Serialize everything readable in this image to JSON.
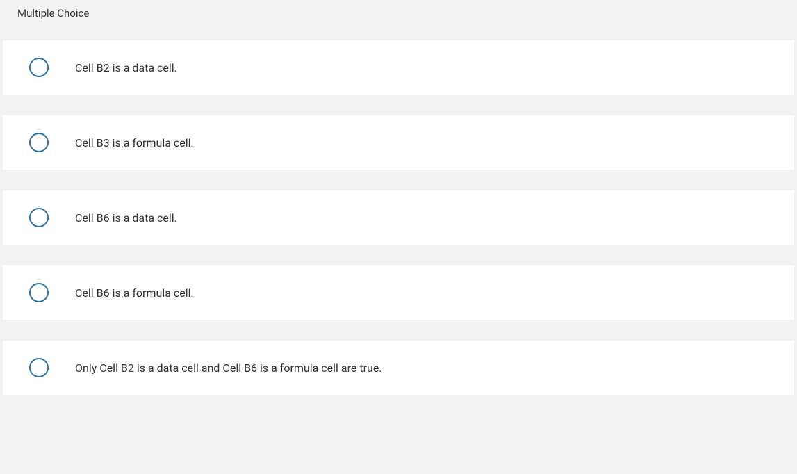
{
  "header": {
    "title": "Multiple Choice"
  },
  "options": [
    {
      "label": "Cell B2 is a data cell."
    },
    {
      "label": "Cell B3 is a formula cell."
    },
    {
      "label": "Cell B6 is a data cell."
    },
    {
      "label": "Cell B6 is a formula cell."
    },
    {
      "label": "Only Cell B2 is a data cell and Cell B6 is a formula cell are true."
    }
  ]
}
